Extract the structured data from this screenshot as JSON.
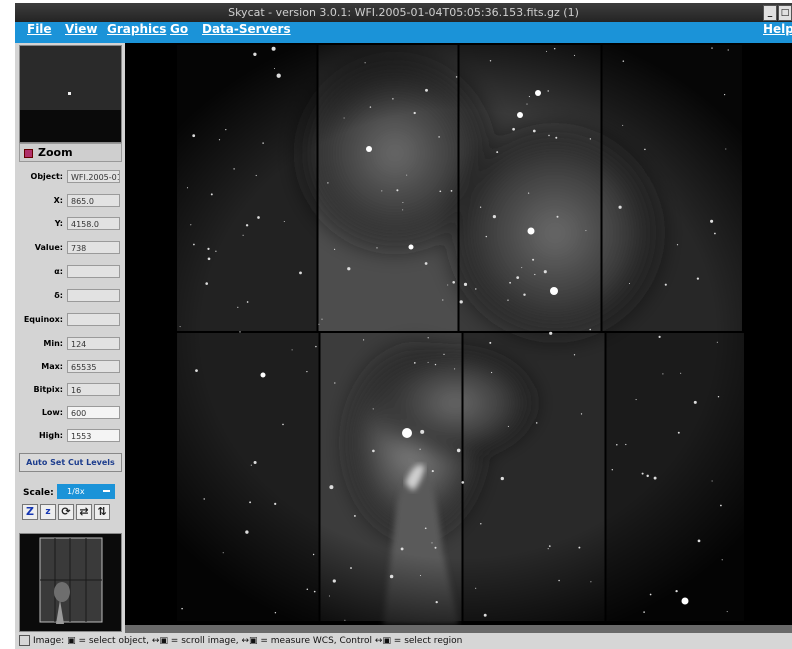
{
  "window": {
    "title": "Skycat - version 3.0.1: WFI.2005-01-04T05:05:36.153.fits.gz (1)"
  },
  "menubar": {
    "file": "File",
    "view": "View",
    "graphics": "Graphics",
    "go": "Go",
    "data_servers": "Data-Servers",
    "help": "Help"
  },
  "zoom": {
    "label": "Zoom"
  },
  "fields": {
    "object": {
      "label": "Object:",
      "value": "WFI.2005-01-0"
    },
    "x": {
      "label": "X:",
      "value": "865.0"
    },
    "y": {
      "label": "Y:",
      "value": "4158.0"
    },
    "value": {
      "label": "Value:",
      "value": "738"
    },
    "alpha": {
      "label": "α:",
      "value": ""
    },
    "delta": {
      "label": "δ:",
      "value": ""
    },
    "equinox": {
      "label": "Equinox:",
      "value": ""
    },
    "min": {
      "label": "Min:",
      "value": "124"
    },
    "max": {
      "label": "Max:",
      "value": "65535"
    },
    "bitpix": {
      "label": "Bitpix:",
      "value": "16"
    },
    "low": {
      "label": "Low:",
      "value": "600"
    },
    "high": {
      "label": "High:",
      "value": "1553"
    }
  },
  "auto_cut": {
    "label": "Auto Set Cut Levels"
  },
  "scale": {
    "label": "Scale:",
    "value": "1/8x"
  },
  "toolbar": {
    "zoom_in": "Z",
    "zoom_out": "z",
    "rotate": "⟳",
    "flip_x": "⇄",
    "flip_y": "⇅"
  },
  "status": {
    "text": "Image: ▣ = select object, ↔▣ = scroll image, ↔▣ = measure WCS, Control ↔▣ = select region"
  },
  "colors": {
    "menubar": "#1b93d8",
    "titlebar": "#2c2c2c",
    "panel": "#d4d4d4",
    "image_bg": "#000000"
  }
}
